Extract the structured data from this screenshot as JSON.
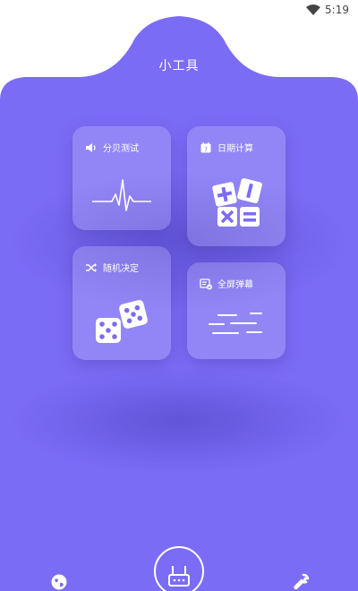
{
  "status_bar": {
    "time": "5:19",
    "wifi_icon": "wifi-icon"
  },
  "page": {
    "title": "小工具",
    "background_color": "#7b6cf6"
  },
  "tools": [
    {
      "label": "分贝测试",
      "icon": "speaker-icon",
      "art": "heartbeat-line"
    },
    {
      "label": "日期计算",
      "icon": "calendar-icon",
      "art": "math-symbols"
    },
    {
      "label": "随机决定",
      "icon": "shuffle-icon",
      "art": "dice"
    },
    {
      "label": "全屏弹幕",
      "icon": "screen-message-icon",
      "art": "scrolling-lines"
    }
  ],
  "bottom_nav": {
    "left_icon": "globe-icon",
    "center_icon": "router-icon",
    "right_icon": "wrench-icon"
  }
}
